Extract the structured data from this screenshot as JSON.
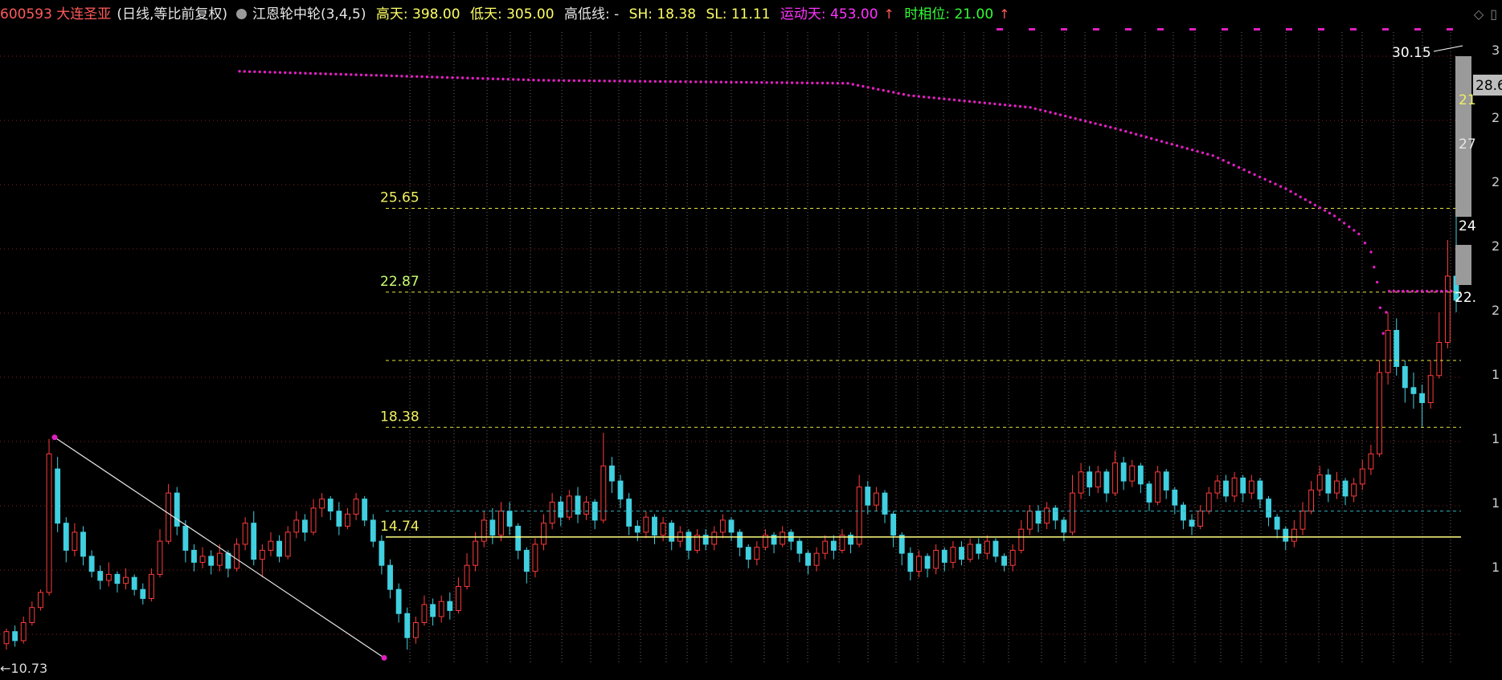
{
  "header": {
    "code_name": "600593 大连圣亚",
    "mode": "(日线,等比前复权)",
    "indicator": "江恩轮中轮(3,4,5)",
    "high_days": "高天: 398.00",
    "low_days": "低天: 305.00",
    "highlow_line": "高低线: -",
    "sh": "SH: 18.38",
    "sl": "SL: 11.11",
    "motion_days": "运动天: 453.00",
    "time_phase": "时相位: 21.00"
  },
  "icons": [
    "dot-icon",
    "diamond-icon",
    "window-icon",
    "arrow-up-icon"
  ],
  "colors": {
    "up": "#ff3b3b",
    "down": "#40d0e0",
    "gann_line": "#e020c0",
    "level_line": "#e6e640",
    "base_line": "#ffff80",
    "cyan_dash": "#30b0c0",
    "grid": "#8a2020"
  },
  "chart_data": {
    "type": "candlestick",
    "title": "600593 大连圣亚",
    "levels": [
      {
        "value": 25.65,
        "label": "25.65"
      },
      {
        "value": 22.87,
        "label": "22.87"
      },
      {
        "value": 18.38,
        "label": "18.38"
      },
      {
        "value": 14.74,
        "label": "14.74"
      }
    ],
    "unlabeled_levels": [
      20.6,
      15.6
    ],
    "annotations": [
      {
        "text": "30.15",
        "value": 30.15
      },
      {
        "text": "←10.73",
        "value": 10.73
      }
    ],
    "right_labels": [
      "28.6",
      "27",
      "24",
      "22.",
      "21"
    ],
    "axis_ticks": [
      "3",
      "2",
      "2",
      "2",
      "2",
      "1",
      "1",
      "1",
      "1"
    ],
    "ylim": [
      10.5,
      31.5
    ],
    "trend_line": {
      "from": 18.05,
      "to": 10.73
    },
    "candles": [
      [
        11.2,
        11.6,
        11.0,
        11.7
      ],
      [
        11.6,
        11.3,
        11.1,
        11.8
      ],
      [
        11.3,
        11.9,
        11.2,
        12.1
      ],
      [
        11.9,
        12.4,
        11.8,
        12.6
      ],
      [
        12.4,
        12.9,
        12.3,
        13.0
      ],
      [
        12.9,
        17.5,
        12.8,
        18.0
      ],
      [
        17.0,
        15.2,
        14.9,
        17.4
      ],
      [
        15.2,
        14.3,
        13.9,
        15.4
      ],
      [
        14.3,
        14.9,
        14.1,
        15.2
      ],
      [
        14.9,
        14.1,
        13.8,
        15.1
      ],
      [
        14.1,
        13.6,
        13.4,
        14.3
      ],
      [
        13.6,
        13.3,
        13.0,
        13.8
      ],
      [
        13.3,
        13.5,
        13.1,
        13.9
      ],
      [
        13.5,
        13.2,
        12.9,
        13.6
      ],
      [
        13.2,
        13.4,
        13.0,
        13.7
      ],
      [
        13.4,
        13.0,
        12.8,
        13.5
      ],
      [
        13.0,
        12.7,
        12.5,
        13.2
      ],
      [
        12.7,
        13.5,
        12.6,
        13.7
      ],
      [
        13.5,
        14.6,
        13.4,
        15.0
      ],
      [
        14.6,
        16.2,
        14.5,
        16.5
      ],
      [
        16.2,
        15.1,
        14.8,
        16.4
      ],
      [
        15.1,
        14.3,
        13.9,
        15.3
      ],
      [
        14.3,
        13.9,
        13.6,
        14.5
      ],
      [
        13.9,
        14.1,
        13.7,
        14.4
      ],
      [
        14.1,
        13.8,
        13.5,
        14.3
      ],
      [
        13.8,
        14.2,
        13.6,
        14.5
      ],
      [
        14.2,
        13.7,
        13.4,
        14.3
      ],
      [
        13.7,
        14.5,
        13.6,
        14.7
      ],
      [
        14.5,
        15.2,
        14.3,
        15.4
      ],
      [
        15.2,
        14.0,
        13.8,
        15.6
      ],
      [
        14.0,
        14.3,
        13.4,
        14.5
      ],
      [
        14.3,
        14.6,
        14.1,
        14.9
      ],
      [
        14.6,
        14.1,
        13.9,
        14.8
      ],
      [
        14.1,
        14.9,
        14.0,
        15.1
      ],
      [
        14.9,
        15.3,
        14.7,
        15.6
      ],
      [
        15.3,
        14.9,
        14.6,
        15.5
      ],
      [
        14.9,
        15.7,
        14.8,
        16.0
      ],
      [
        15.7,
        16.0,
        15.4,
        16.2
      ],
      [
        16.0,
        15.6,
        15.3,
        16.1
      ],
      [
        15.6,
        15.1,
        14.8,
        15.9
      ],
      [
        15.1,
        15.5,
        15.0,
        15.7
      ],
      [
        15.5,
        16.0,
        15.3,
        16.2
      ],
      [
        16.0,
        15.3,
        15.1,
        16.1
      ],
      [
        15.3,
        14.6,
        14.4,
        15.5
      ],
      [
        14.6,
        13.8,
        13.5,
        14.8
      ],
      [
        13.8,
        13.0,
        12.7,
        14.0
      ],
      [
        13.0,
        12.2,
        11.9,
        13.2
      ],
      [
        12.2,
        11.4,
        11.0,
        12.4
      ],
      [
        11.4,
        11.9,
        11.2,
        12.1
      ],
      [
        11.9,
        12.5,
        11.8,
        12.8
      ],
      [
        12.5,
        12.1,
        11.8,
        12.7
      ],
      [
        12.1,
        12.6,
        11.9,
        12.8
      ],
      [
        12.6,
        12.3,
        12.0,
        12.9
      ],
      [
        12.3,
        13.1,
        12.2,
        13.4
      ],
      [
        13.1,
        13.8,
        13.0,
        14.2
      ],
      [
        13.8,
        14.6,
        13.6,
        14.9
      ],
      [
        14.6,
        15.3,
        14.4,
        15.6
      ],
      [
        15.3,
        14.8,
        14.5,
        15.7
      ],
      [
        14.8,
        15.6,
        14.6,
        15.9
      ],
      [
        15.6,
        15.1,
        14.8,
        15.9
      ],
      [
        15.1,
        14.3,
        14.0,
        15.2
      ],
      [
        14.3,
        13.6,
        13.2,
        14.4
      ],
      [
        13.6,
        14.5,
        13.4,
        14.7
      ],
      [
        14.5,
        15.2,
        14.3,
        15.5
      ],
      [
        15.2,
        15.9,
        15.0,
        16.2
      ],
      [
        15.9,
        15.4,
        15.1,
        16.1
      ],
      [
        15.4,
        16.1,
        15.3,
        16.3
      ],
      [
        16.1,
        15.5,
        15.2,
        16.4
      ],
      [
        15.5,
        15.9,
        15.3,
        16.1
      ],
      [
        15.9,
        15.3,
        15.0,
        16.0
      ],
      [
        15.3,
        17.1,
        15.2,
        18.2
      ],
      [
        17.1,
        16.6,
        16.2,
        17.4
      ],
      [
        16.6,
        16.0,
        15.7,
        16.8
      ],
      [
        16.0,
        15.1,
        14.8,
        16.2
      ],
      [
        15.1,
        14.9,
        14.6,
        15.3
      ],
      [
        14.9,
        15.4,
        14.7,
        15.6
      ],
      [
        15.4,
        14.8,
        14.5,
        15.5
      ],
      [
        14.8,
        15.2,
        14.6,
        15.4
      ],
      [
        15.2,
        14.6,
        14.3,
        15.3
      ],
      [
        14.6,
        14.9,
        14.4,
        15.1
      ],
      [
        14.9,
        14.3,
        14.0,
        15.0
      ],
      [
        14.3,
        14.8,
        14.2,
        15.0
      ],
      [
        14.8,
        14.5,
        14.3,
        15.0
      ],
      [
        14.5,
        14.9,
        14.3,
        15.1
      ],
      [
        14.9,
        15.3,
        14.7,
        15.5
      ],
      [
        15.3,
        14.9,
        14.6,
        15.4
      ],
      [
        14.9,
        14.4,
        14.1,
        15.0
      ],
      [
        14.4,
        14.0,
        13.7,
        14.5
      ],
      [
        14.0,
        14.4,
        13.8,
        14.6
      ],
      [
        14.4,
        14.8,
        14.3,
        15.0
      ],
      [
        14.8,
        14.5,
        14.2,
        14.9
      ],
      [
        14.5,
        14.9,
        14.4,
        15.1
      ],
      [
        14.9,
        14.6,
        14.3,
        15.0
      ],
      [
        14.6,
        14.2,
        13.9,
        14.7
      ],
      [
        14.2,
        13.8,
        13.5,
        14.3
      ],
      [
        13.8,
        14.2,
        13.6,
        14.4
      ],
      [
        14.2,
        14.6,
        14.0,
        14.8
      ],
      [
        14.6,
        14.3,
        14.0,
        14.8
      ],
      [
        14.3,
        14.8,
        14.2,
        15.0
      ],
      [
        14.8,
        14.5,
        14.2,
        14.9
      ],
      [
        14.5,
        16.4,
        14.4,
        16.8
      ],
      [
        16.4,
        15.8,
        15.5,
        16.6
      ],
      [
        15.8,
        16.2,
        15.6,
        16.4
      ],
      [
        16.2,
        15.5,
        15.2,
        16.3
      ],
      [
        15.5,
        14.8,
        14.4,
        15.6
      ],
      [
        14.8,
        14.2,
        13.8,
        14.9
      ],
      [
        14.2,
        13.6,
        13.3,
        14.4
      ],
      [
        13.6,
        14.1,
        13.4,
        14.3
      ],
      [
        14.1,
        13.7,
        13.4,
        14.2
      ],
      [
        13.7,
        14.3,
        13.5,
        14.5
      ],
      [
        14.3,
        13.9,
        13.6,
        14.4
      ],
      [
        13.9,
        14.4,
        13.7,
        14.6
      ],
      [
        14.4,
        14.0,
        13.8,
        14.6
      ],
      [
        14.0,
        14.5,
        13.9,
        14.7
      ],
      [
        14.5,
        14.2,
        14.0,
        14.7
      ],
      [
        14.2,
        14.6,
        14.0,
        14.8
      ],
      [
        14.6,
        14.1,
        13.9,
        14.7
      ],
      [
        14.1,
        13.8,
        13.6,
        14.2
      ],
      [
        13.8,
        14.3,
        13.6,
        14.5
      ],
      [
        14.3,
        15.0,
        14.2,
        15.3
      ],
      [
        15.0,
        15.6,
        14.8,
        15.8
      ],
      [
        15.6,
        15.2,
        14.9,
        15.8
      ],
      [
        15.2,
        15.7,
        15.0,
        15.9
      ],
      [
        15.7,
        15.3,
        15.0,
        15.8
      ],
      [
        15.3,
        14.9,
        14.6,
        15.4
      ],
      [
        14.9,
        16.2,
        14.8,
        16.8
      ],
      [
        16.2,
        16.9,
        16.0,
        17.2
      ],
      [
        16.9,
        16.4,
        16.1,
        17.1
      ],
      [
        16.4,
        16.9,
        16.2,
        17.1
      ],
      [
        16.9,
        16.2,
        15.9,
        17.0
      ],
      [
        16.2,
        17.2,
        16.1,
        17.6
      ],
      [
        17.2,
        16.6,
        16.3,
        17.4
      ],
      [
        16.6,
        17.1,
        16.4,
        17.3
      ],
      [
        17.1,
        16.5,
        16.2,
        17.2
      ],
      [
        16.5,
        15.9,
        15.6,
        16.6
      ],
      [
        15.9,
        16.9,
        15.8,
        17.1
      ],
      [
        16.9,
        16.3,
        16.0,
        17.0
      ],
      [
        16.3,
        15.8,
        15.5,
        16.4
      ],
      [
        15.8,
        15.3,
        15.0,
        15.9
      ],
      [
        15.3,
        15.1,
        14.8,
        15.5
      ],
      [
        15.1,
        15.6,
        15.0,
        15.8
      ],
      [
        15.6,
        16.2,
        15.5,
        16.4
      ],
      [
        16.2,
        16.6,
        16.0,
        16.8
      ],
      [
        16.6,
        16.1,
        15.9,
        16.8
      ],
      [
        16.1,
        16.7,
        15.9,
        16.9
      ],
      [
        16.7,
        16.2,
        15.9,
        16.8
      ],
      [
        16.2,
        16.6,
        16.0,
        16.8
      ],
      [
        16.6,
        16.0,
        15.7,
        16.7
      ],
      [
        16.0,
        15.4,
        15.1,
        16.1
      ],
      [
        15.4,
        15.0,
        14.7,
        15.5
      ],
      [
        15.0,
        14.6,
        14.3,
        15.1
      ],
      [
        14.6,
        15.0,
        14.4,
        15.3
      ],
      [
        15.0,
        15.6,
        14.8,
        15.9
      ],
      [
        15.6,
        16.3,
        15.5,
        16.6
      ],
      [
        16.3,
        16.8,
        16.1,
        17.1
      ],
      [
        16.8,
        16.2,
        15.9,
        17.0
      ],
      [
        16.2,
        16.6,
        16.0,
        16.9
      ],
      [
        16.6,
        16.1,
        15.8,
        16.7
      ],
      [
        16.1,
        16.5,
        15.9,
        16.7
      ],
      [
        16.5,
        17.0,
        16.3,
        17.3
      ],
      [
        17.0,
        17.5,
        16.8,
        17.8
      ],
      [
        17.5,
        20.2,
        17.4,
        20.6
      ],
      [
        20.2,
        21.6,
        19.8,
        22.2
      ],
      [
        21.6,
        20.4,
        20.1,
        22.0
      ],
      [
        20.4,
        19.7,
        19.2,
        20.6
      ],
      [
        19.7,
        19.5,
        19.0,
        20.2
      ],
      [
        19.5,
        19.2,
        18.4,
        19.8
      ],
      [
        19.2,
        20.1,
        19.0,
        20.6
      ],
      [
        20.1,
        21.2,
        20.0,
        22.2
      ],
      [
        21.2,
        23.4,
        21.0,
        24.6
      ],
      [
        23.4,
        22.6,
        22.2,
        27.6
      ]
    ],
    "gann_points": [
      [
        0.0,
        30.2
      ],
      [
        0.25,
        29.9
      ],
      [
        0.5,
        29.8
      ],
      [
        0.55,
        29.4
      ],
      [
        0.65,
        29.0
      ],
      [
        0.72,
        28.3
      ],
      [
        0.8,
        27.4
      ],
      [
        0.86,
        26.3
      ],
      [
        0.9,
        25.4
      ],
      [
        0.92,
        24.8
      ],
      [
        0.93,
        24.2
      ],
      [
        0.935,
        23.2
      ],
      [
        0.94,
        21.5
      ],
      [
        0.945,
        22.9
      ],
      [
        0.96,
        22.9
      ],
      [
        1.0,
        22.9
      ]
    ]
  },
  "bottom": {
    "label": "←10.73"
  }
}
